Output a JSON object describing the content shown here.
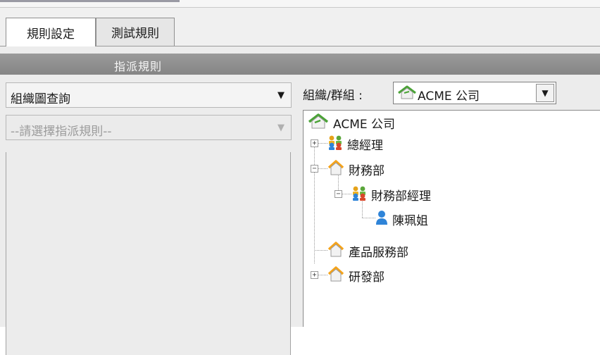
{
  "tabs": [
    {
      "label": "規則設定",
      "active": true
    },
    {
      "label": "測試規則",
      "active": false
    }
  ],
  "header": {
    "title": "指派規則"
  },
  "left": {
    "query_combo": {
      "value": "組織圖查詢"
    },
    "rule_combo": {
      "value": "--請選擇指派規則--",
      "disabled": true
    }
  },
  "right": {
    "org_label": "組織/群組 :",
    "org_combo": {
      "value": "ACME 公司",
      "icon": "org-house-icon"
    },
    "tree": {
      "root": {
        "label": "ACME 公司",
        "icon": "org-house-icon"
      },
      "nodes": [
        {
          "label": "總經理",
          "icon": "group-people-icon",
          "expander": "+"
        },
        {
          "label": "財務部",
          "icon": "department-house-icon",
          "expander": "-"
        },
        {
          "label": "財務部經理",
          "icon": "group-people-icon",
          "expander": "-"
        },
        {
          "label": "陳珮姐",
          "icon": "user-icon"
        },
        {
          "label": "產品服務部",
          "icon": "department-house-icon"
        },
        {
          "label": "研發部",
          "icon": "department-house-icon",
          "expander": "+"
        }
      ]
    }
  },
  "colors": {
    "header_bg": "#8e8e8e",
    "house_roof": "#f5a31a",
    "org_roof": "#4aa336",
    "user_blue": "#2f84d8"
  }
}
